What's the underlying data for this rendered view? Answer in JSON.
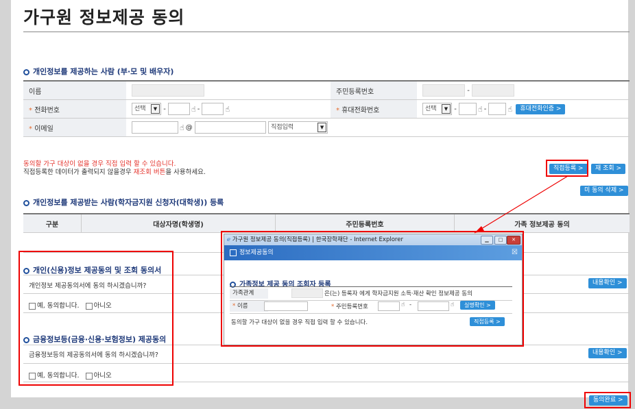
{
  "page_title": "가구원 정보제공 동의",
  "sec1": {
    "title": "개인정보를 제공하는 사람 (부·모 및 배우자)",
    "name_label": "이름",
    "rrn_label": "주민등록번호",
    "rrn_sep": "-",
    "phone_label": "전화번호",
    "phone_select": "선택",
    "dash": "-",
    "mobile_label": "휴대전화번호",
    "mobile_select": "선택",
    "mobile_auth_btn": "휴대전화인증 >",
    "email_label": "이메일",
    "email_at": "@",
    "email_select": "직접입력"
  },
  "notes": {
    "line1": "동의할 가구 대상이 없을 경우 직접 입력 할 수 있습니다.",
    "line2_a": "직접등록한 데이터가 출력되지 않을경우 ",
    "line2_b": "재조회 버튼",
    "line2_c": "을 사용하세요."
  },
  "buttons": {
    "direct_reg": "직접등록 >",
    "requery": "재 조회 >",
    "delete_unagreed": "미 동의 삭제 >",
    "confirm1": "내용확인 >",
    "confirm2": "내용확인 >",
    "finish": "동의완료 >"
  },
  "sec2": {
    "title": "개인정보를 제공받는 사람(학자금지원 신청자(대학생)) 등록",
    "cols": [
      "구분",
      "대상자명(학생명)",
      "주민등록번호",
      "가족 정보제공 동의"
    ]
  },
  "consent1": {
    "title": "개인(신용)정보 제공동의 및 조회 동의서",
    "question": "개인정보 제공동의서에 동의 하시겠습니까?",
    "yes": "예, 동의합니다.",
    "no": "아니오"
  },
  "consent2": {
    "title": "금융정보등(금융·신용·보험정보) 제공동의",
    "question": "금융정보등의 제공동의서에 동의 하시겠습니까?",
    "yes": "예, 동의합니다.",
    "no": "아니오"
  },
  "popup": {
    "window_title": "가구원 정보제공 동의(직접등록) | 한국장학재단 - Internet Explorer",
    "bar_title": "정보제공동의",
    "section": "가족정보 제공 동의 조회자 등록",
    "relation_label": "가족관계",
    "relation_text": "은(는) 등록자 에게 학자금지원 소득·재산 확인 정보제공 동의",
    "name_label": "이름",
    "rrn_label": "주민등록번호",
    "dash": "-",
    "verify_btn": "실명확인 >",
    "note": "동의할 가구 대상이 없을 경우 직접 입력 할 수 있습니다.",
    "direct_btn": "직접등록 >"
  }
}
